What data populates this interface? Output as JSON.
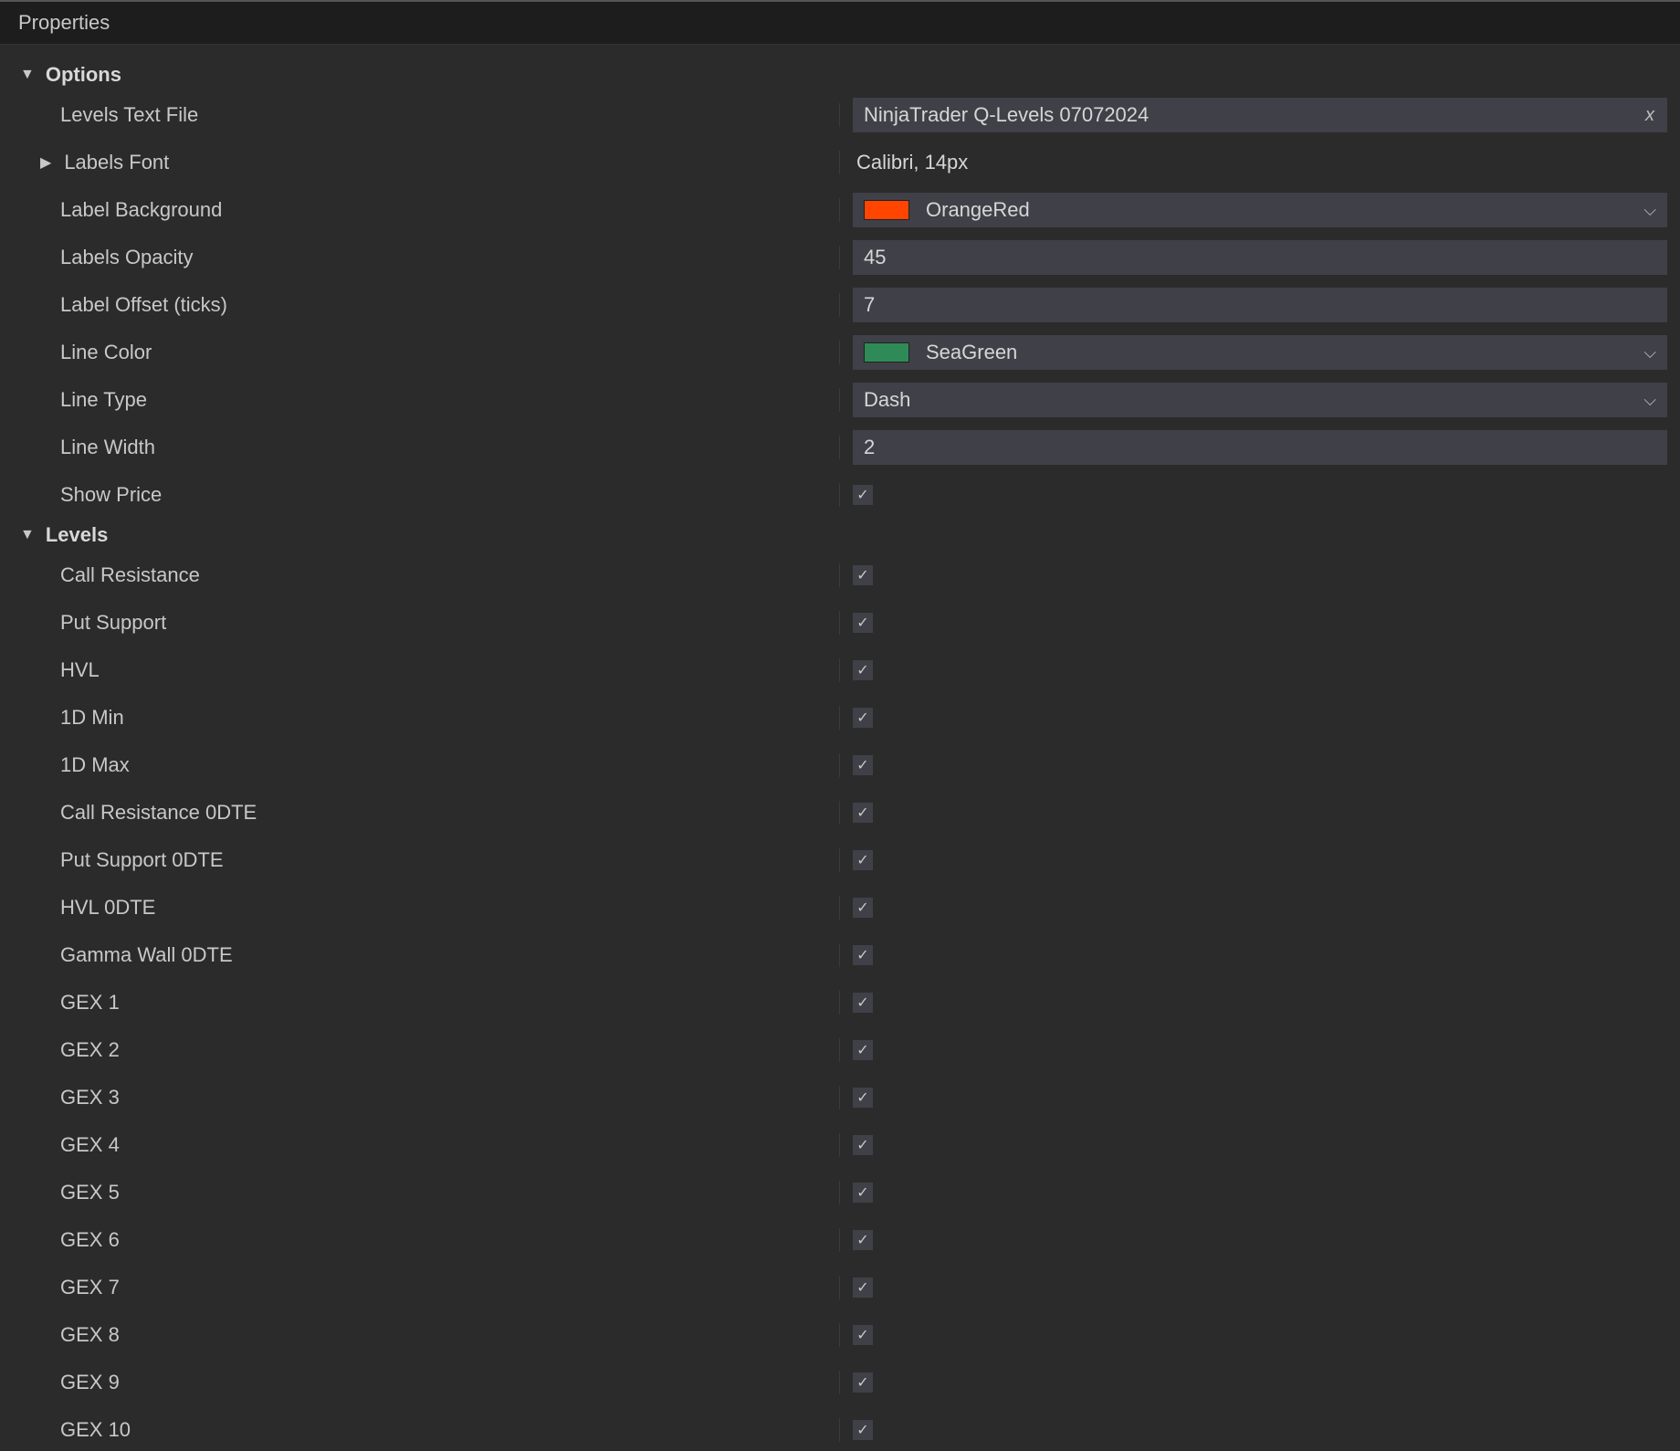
{
  "panel": {
    "title": "Properties"
  },
  "sections": {
    "options": {
      "title": "Options",
      "rows": {
        "levels_text_file": {
          "label": "Levels Text File",
          "value": "NinjaTrader Q-Levels 07072024"
        },
        "labels_font": {
          "label": "Labels Font",
          "value": "Calibri, 14px"
        },
        "label_background": {
          "label": "Label Background",
          "color_name": "OrangeRed",
          "color_hex": "#ff4500"
        },
        "labels_opacity": {
          "label": "Labels Opacity",
          "value": "45"
        },
        "label_offset": {
          "label": "Label Offset (ticks)",
          "value": "7"
        },
        "line_color": {
          "label": "Line Color",
          "color_name": "SeaGreen",
          "color_hex": "#2e8b57"
        },
        "line_type": {
          "label": "Line Type",
          "value": "Dash"
        },
        "line_width": {
          "label": "Line Width",
          "value": "2"
        },
        "show_price": {
          "label": "Show Price",
          "checked": true
        }
      }
    },
    "levels": {
      "title": "Levels",
      "items": [
        {
          "label": "Call Resistance",
          "checked": true
        },
        {
          "label": "Put Support",
          "checked": true
        },
        {
          "label": "HVL",
          "checked": true
        },
        {
          "label": "1D Min",
          "checked": true
        },
        {
          "label": "1D Max",
          "checked": true
        },
        {
          "label": "Call Resistance 0DTE",
          "checked": true
        },
        {
          "label": "Put Support 0DTE",
          "checked": true
        },
        {
          "label": "HVL 0DTE",
          "checked": true
        },
        {
          "label": "Gamma Wall 0DTE",
          "checked": true
        },
        {
          "label": "GEX 1",
          "checked": true
        },
        {
          "label": "GEX 2",
          "checked": true
        },
        {
          "label": "GEX 3",
          "checked": true
        },
        {
          "label": "GEX 4",
          "checked": true
        },
        {
          "label": "GEX 5",
          "checked": true
        },
        {
          "label": "GEX 6",
          "checked": true
        },
        {
          "label": "GEX 7",
          "checked": true
        },
        {
          "label": "GEX 8",
          "checked": true
        },
        {
          "label": "GEX 9",
          "checked": true
        },
        {
          "label": "GEX 10",
          "checked": true
        }
      ]
    }
  },
  "glyphs": {
    "clear_x": "x",
    "check": "✓",
    "chev_down": "⌵",
    "tri_down": "▼",
    "tri_right": "▶"
  }
}
